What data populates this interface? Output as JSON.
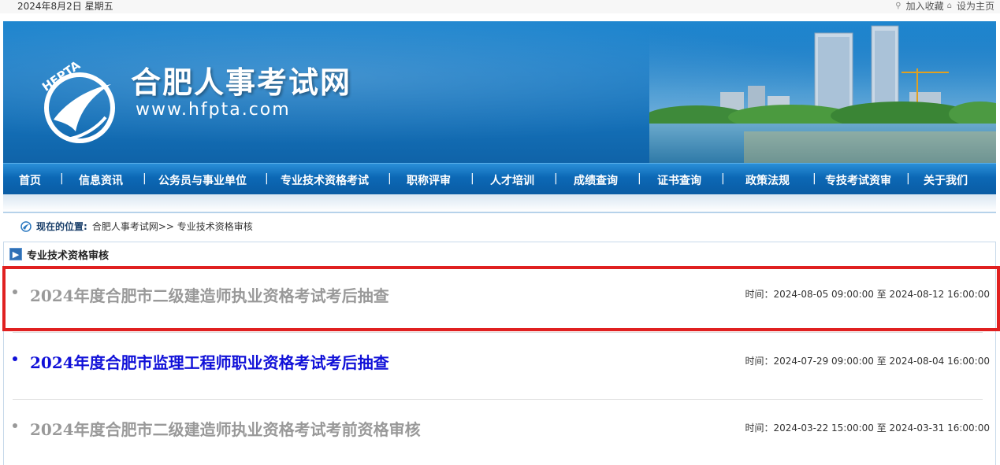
{
  "topbar": {
    "date": "2024年8月2日 星期五",
    "favorite_label": "加入收藏",
    "homepage_label": "设为主页",
    "favorite_icon": "search-icon",
    "homepage_icon": "home-icon"
  },
  "banner": {
    "logo_text": "HFPTA",
    "site_name": "合肥人事考试网",
    "site_url": "www.hfpta.com"
  },
  "nav": {
    "items": [
      {
        "label": "首页"
      },
      {
        "label": "信息资讯"
      },
      {
        "label": "公务员与事业单位"
      },
      {
        "label": "专业技术资格考试"
      },
      {
        "label": "职称评审"
      },
      {
        "label": "人才培训"
      },
      {
        "label": "成绩查询"
      },
      {
        "label": "证书查询"
      },
      {
        "label": "政策法规"
      },
      {
        "label": "专技考试资审"
      },
      {
        "label": "关于我们"
      }
    ],
    "separator": "|"
  },
  "breadcrumb": {
    "label": "现在的位置:",
    "path": "合肥人事考试网>> 专业技术资格审核"
  },
  "panel": {
    "title": "专业技术资格审核",
    "icon": "arrow-right-icon"
  },
  "notices": [
    {
      "title": "2024年度合肥市二级建造师执业资格考试考后抽查",
      "time": "时间：2024-08-05 09:00:00 至 2024-08-12 16:00:00",
      "state": "grey"
    },
    {
      "title": "2024年度合肥市监理工程师职业资格考试考后抽查",
      "time": "时间：2024-07-29 09:00:00 至 2024-08-04 16:00:00",
      "state": "blue"
    },
    {
      "title": "2024年度合肥市二级建造师执业资格考试考前资格审核",
      "time": "时间：2024-03-22 15:00:00 至 2024-03-31 16:00:00",
      "state": "grey"
    }
  ],
  "colors": {
    "highlight": "#e02020",
    "link_active": "#1010d8",
    "link_inactive": "#999999",
    "nav_bg": "#0c68b5"
  }
}
